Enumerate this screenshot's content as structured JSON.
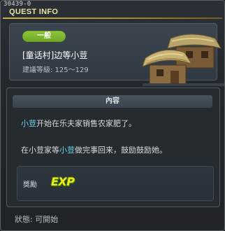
{
  "window": {
    "quest_id": "30439-0",
    "title": "QUEST INFO"
  },
  "header": {
    "badge": "一般",
    "quest_name": "[童话村]边等小荳",
    "level_text": "建議等級: 125～129",
    "image_icon": "thatched-hut-icon"
  },
  "content": {
    "section_title": "內容",
    "line1": {
      "highlight": "小荳",
      "rest": "开始在乐夫家销售农家肥了。"
    },
    "line2": {
      "prefix": "在小荳家等",
      "highlight": "小荳",
      "rest": "做完事回来，鼓励鼓励她。"
    }
  },
  "reward": {
    "label": "獎勵",
    "exp_text": "EXP"
  },
  "status": {
    "text": "狀態: 可開始"
  },
  "colors": {
    "title": "#e9e3a6",
    "badge_green": "#7cb82f",
    "highlight_cyan": "#66d6e6",
    "exp_yellow": "#f5e81a"
  }
}
